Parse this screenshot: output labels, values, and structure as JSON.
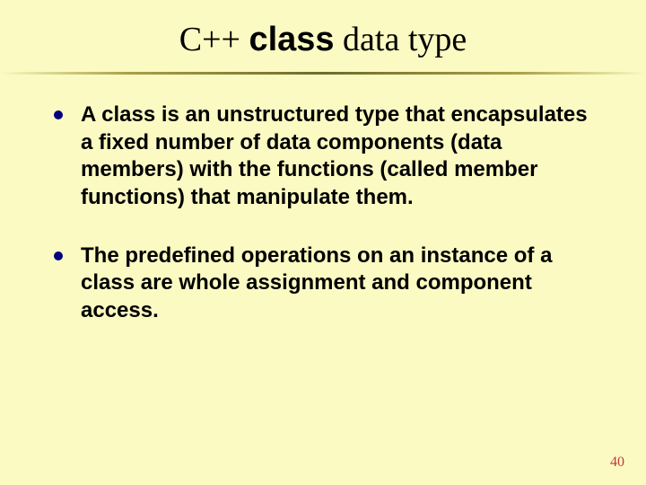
{
  "title": {
    "p1": "C++ ",
    "p2_bold": "class",
    "p3": " data type"
  },
  "bullets": [
    "A class is an unstructured type that encapsulates a fixed number of data components (data members) with the functions (called member functions) that manipulate them.",
    "The predefined operations on an instance of a class are whole assignment and component access."
  ],
  "slide_number": "40"
}
